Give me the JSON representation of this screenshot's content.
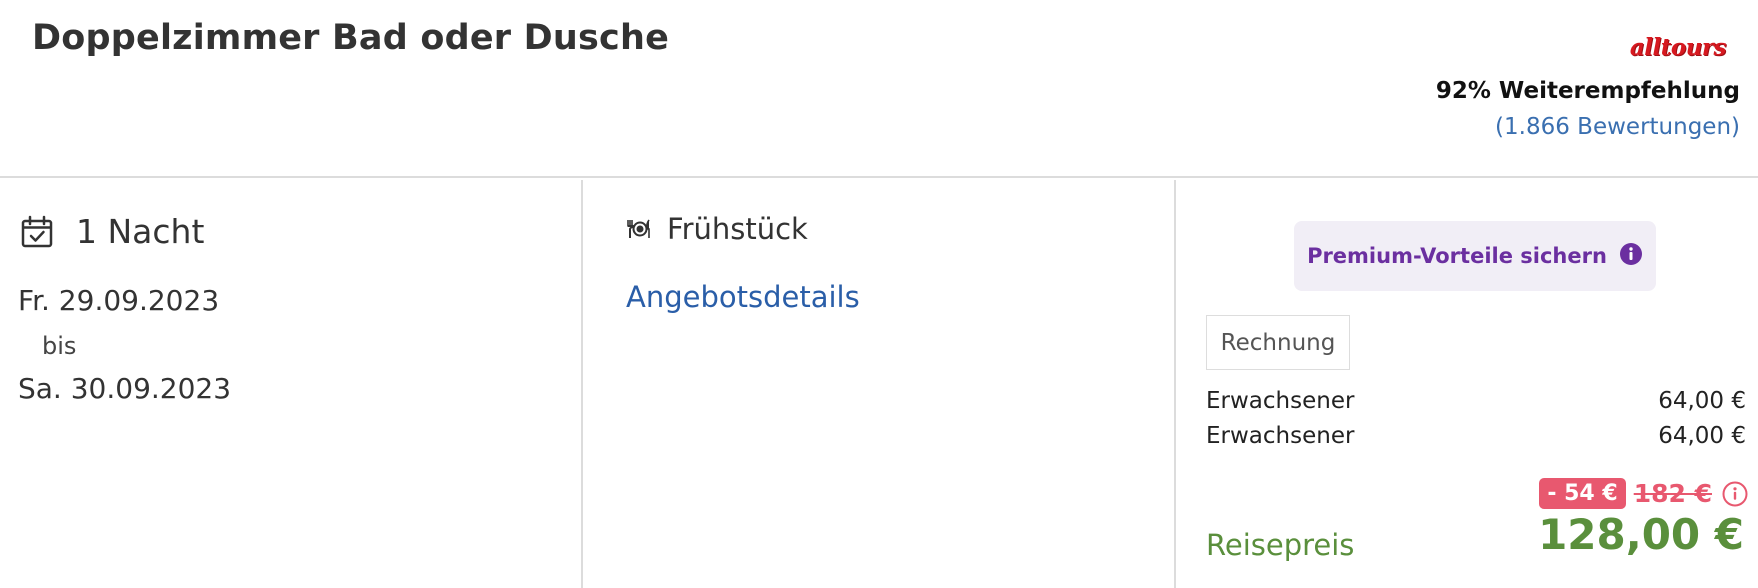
{
  "offer": {
    "room_title": "Doppelzimmer Bad oder Dusche",
    "brand_logo": "alltours",
    "recommendation": "92% Weiterempfehlung",
    "reviews": "(1.866 Bewertungen)"
  },
  "stay": {
    "calendar_icon": "calendar-check-icon",
    "nights": "1 Nacht",
    "date_from": "Fr. 29.09.2023",
    "bis": "bis",
    "date_to": "Sa. 30.09.2023"
  },
  "board": {
    "icon": "plate-cutlery-icon",
    "label": "Frühstück",
    "details_link": "Angebotsdetails"
  },
  "pricing": {
    "premium_label": "Premium-Vorteile sichern",
    "invoice_button": "Rechnung",
    "rows": [
      {
        "label": "Erwachsener",
        "amount": "64,00 €"
      },
      {
        "label": "Erwachsener",
        "amount": "64,00 €"
      }
    ],
    "discount": "- 54 €",
    "old_price": "182 €",
    "total_label": "Reisepreis",
    "total_price": "128,00 €"
  },
  "colors": {
    "accent_blue": "#2a5ea8",
    "premium_purple": "#6b2fa0",
    "discount_red": "#e8586f",
    "price_green": "#5a8f3c",
    "brand_red": "#d71920"
  }
}
